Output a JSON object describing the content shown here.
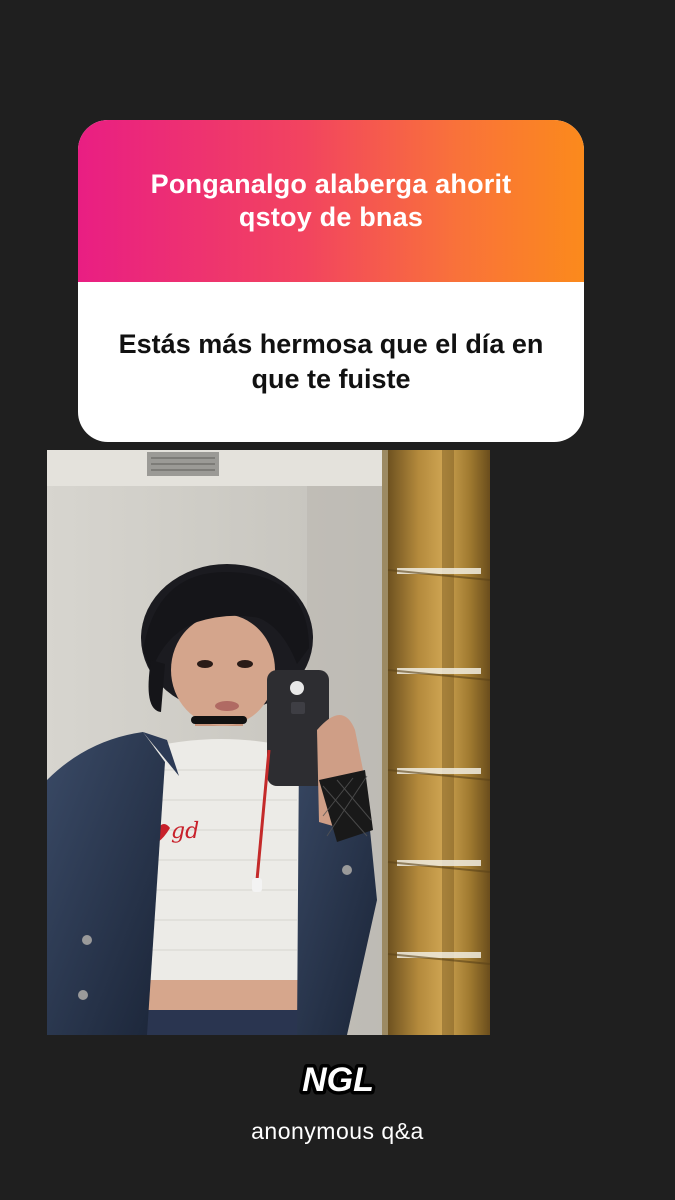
{
  "card": {
    "prompt": "Ponganalgo alaberga ahorit qstoy de bnas",
    "answer": "Estás más hermosa que el día en que te fuiste"
  },
  "branding": {
    "logo_text": "NGL",
    "tagline": "anonymous q&a"
  },
  "colors": {
    "background": "#1f1f1f",
    "gradient_start": "#e91e83",
    "gradient_end": "#fb8a1c",
    "card_body": "#ffffff"
  },
  "photo": {
    "subject": "mirror-selfie-photo"
  }
}
